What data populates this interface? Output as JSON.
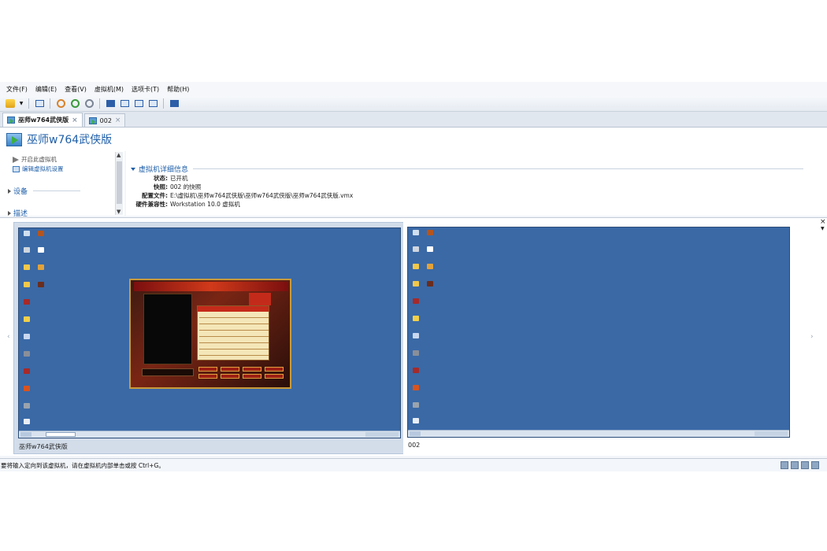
{
  "menu": [
    "文件(F)",
    "编辑(E)",
    "查看(V)",
    "虚拟机(M)",
    "选项卡(T)",
    "帮助(H)"
  ],
  "tabs": [
    {
      "label": "巫师w764武侠版",
      "active": true
    },
    {
      "label": "002",
      "active": false
    }
  ],
  "header": {
    "title": "巫师w764武侠版"
  },
  "left_panel": {
    "power_on": "开启此虚拟机",
    "edit_settings": "编辑虚拟机设置",
    "devices": "设备",
    "description": "描述"
  },
  "details": {
    "title": "虚拟机详细信息",
    "rows": [
      {
        "key": "状态:",
        "value": "已开机"
      },
      {
        "key": "快照:",
        "value": "002 的快照"
      },
      {
        "key": "配置文件:",
        "value": "E:\\虚拟机\\巫师w764武侠版\\巫师w764武侠版\\巫师w764武侠版.vmx"
      },
      {
        "key": "硬件兼容性:",
        "value": "Workstation 10.0 虚拟机"
      }
    ]
  },
  "thumbnails": [
    {
      "label": "巫师w764武侠版",
      "selected": true
    },
    {
      "label": "002",
      "selected": false
    }
  ],
  "status": {
    "message": "要将输入定向到该虚拟机，请在虚拟机内部单击或按 Ctrl+G。"
  },
  "colors": {
    "accent": "#1f5fa9",
    "desktop": "#3a69a6"
  }
}
